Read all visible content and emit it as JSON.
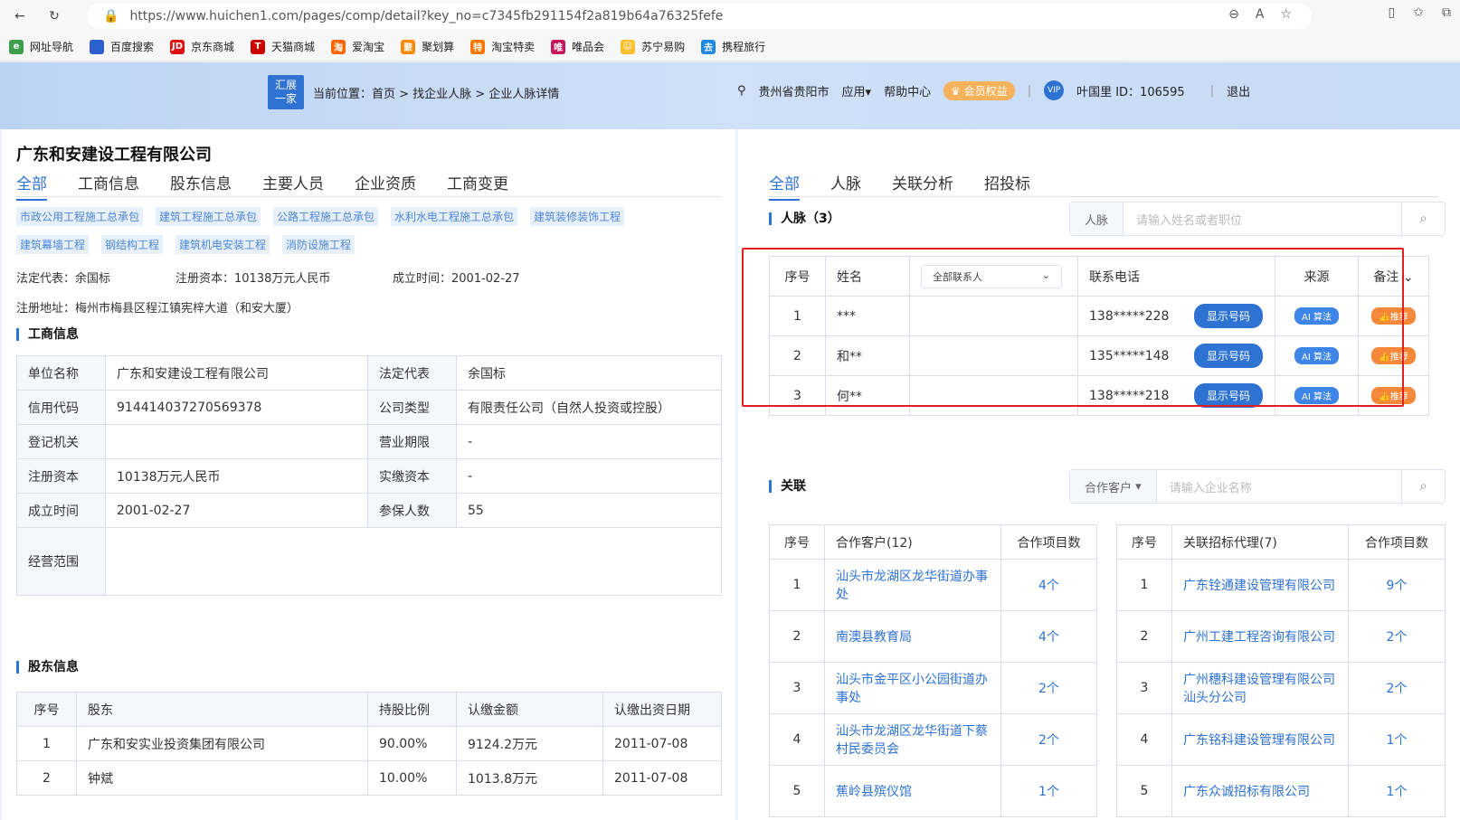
{
  "browser": {
    "url": "https://www.huichen1.com/pages/comp/detail?key_no=c7345fb291154f2a819b64a76325fefe",
    "bookmarks": [
      "网址导航",
      "百度搜索",
      "京东商城",
      "天猫商城",
      "爱淘宝",
      "聚划算",
      "淘宝特卖",
      "唯品会",
      "苏宁易购",
      "携程旅行"
    ]
  },
  "header": {
    "logo_line1": "汇展",
    "logo_line2": "一家",
    "breadcrumb": "当前位置：首页 > 找企业人脉 > 企业人脉详情",
    "location": "贵州省贵阳市",
    "apps": "应用▾",
    "help": "帮助中心",
    "vip": "会员权益",
    "user": "叶国里 ID：106595",
    "logout": "退出"
  },
  "company": {
    "name": "广东和安建设工程有限公司",
    "tabs": [
      "全部",
      "工商信息",
      "股东信息",
      "主要人员",
      "企业资质",
      "工商变更"
    ],
    "tags": [
      "市政公用工程施工总承包",
      "建筑工程施工总承包",
      "公路工程施工总承包",
      "水利水电工程施工总承包",
      "建筑装修装饰工程",
      "建筑幕墙工程",
      "钢结构工程",
      "建筑机电安装工程",
      "消防设施工程"
    ],
    "legal_rep": "法定代表：余国标",
    "capital": "注册资本：10138万元人民币",
    "founded": "成立时间：2001-02-27",
    "address": "注册地址：梅州市梅县区程江镇宪梓大道（和安大厦）"
  },
  "business": {
    "title": "工商信息",
    "rows": [
      [
        "单位名称",
        "广东和安建设工程有限公司",
        "法定代表",
        "余国标"
      ],
      [
        "信用代码",
        "914414037270569378",
        "公司类型",
        "有限责任公司（自然人投资或控股）"
      ],
      [
        "登记机关",
        "",
        "营业期限",
        "-"
      ],
      [
        "注册资本",
        "10138万元人民币",
        "实缴资本",
        "-"
      ],
      [
        "成立时间",
        "2001-02-27",
        "参保人数",
        "55"
      ]
    ],
    "scope_label": "经营范围"
  },
  "shareholders": {
    "title": "股东信息",
    "headers": [
      "序号",
      "股东",
      "持股比例",
      "认缴金额",
      "认缴出资日期"
    ],
    "rows": [
      [
        "1",
        "广东和安实业投资集团有限公司",
        "90.00%",
        "9124.2万元",
        "2011-07-08"
      ],
      [
        "2",
        "钟斌",
        "10.00%",
        "1013.8万元",
        "2011-07-08"
      ]
    ]
  },
  "right": {
    "tabs": [
      "全部",
      "人脉",
      "关联分析",
      "招投标"
    ],
    "contacts_title": "人脉（3）",
    "contacts_search_label": "人脉",
    "contacts_search_placeholder": "请输入姓名或者职位",
    "contacts_headers": {
      "no": "序号",
      "name": "姓名",
      "filter": "全部联系人",
      "phone": "联系电话",
      "source": "来源",
      "note": "备注"
    },
    "contacts": [
      {
        "no": "1",
        "name": "***",
        "phone": "138*****228",
        "btn": "显示号码",
        "source": "算法",
        "note": "推荐"
      },
      {
        "no": "2",
        "name": "和**",
        "phone": "135*****148",
        "btn": "显示号码",
        "source": "算法",
        "note": "推荐"
      },
      {
        "no": "3",
        "name": "何**",
        "phone": "138*****218",
        "btn": "显示号码",
        "source": "算法",
        "note": "推荐"
      }
    ],
    "related_title": "关联",
    "related_search_label": "合作客户",
    "related_search_placeholder": "请输入企业名称",
    "clients_headers": [
      "序号",
      "合作客户(12)",
      "合作项目数"
    ],
    "clients": [
      [
        "1",
        "汕头市龙湖区龙华街道办事处",
        "4个"
      ],
      [
        "2",
        "南澳县教育局",
        "4个"
      ],
      [
        "3",
        "汕头市金平区小公园街道办事处",
        "2个"
      ],
      [
        "4",
        "汕头市龙湖区龙华街道下蔡村民委员会",
        "2个"
      ],
      [
        "5",
        "蕉岭县殡仪馆",
        "1个"
      ]
    ],
    "agents_headers": [
      "序号",
      "关联招标代理(7)",
      "合作项目数"
    ],
    "agents": [
      [
        "1",
        "广东铨通建设管理有限公司",
        "9个"
      ],
      [
        "2",
        "广州工建工程咨询有限公司",
        "2个"
      ],
      [
        "3",
        "广州穗科建设管理有限公司汕头分公司",
        "2个"
      ],
      [
        "4",
        "广东铭科建设管理有限公司",
        "1个"
      ],
      [
        "5",
        "广东众诚招标有限公司",
        "1个"
      ]
    ]
  }
}
